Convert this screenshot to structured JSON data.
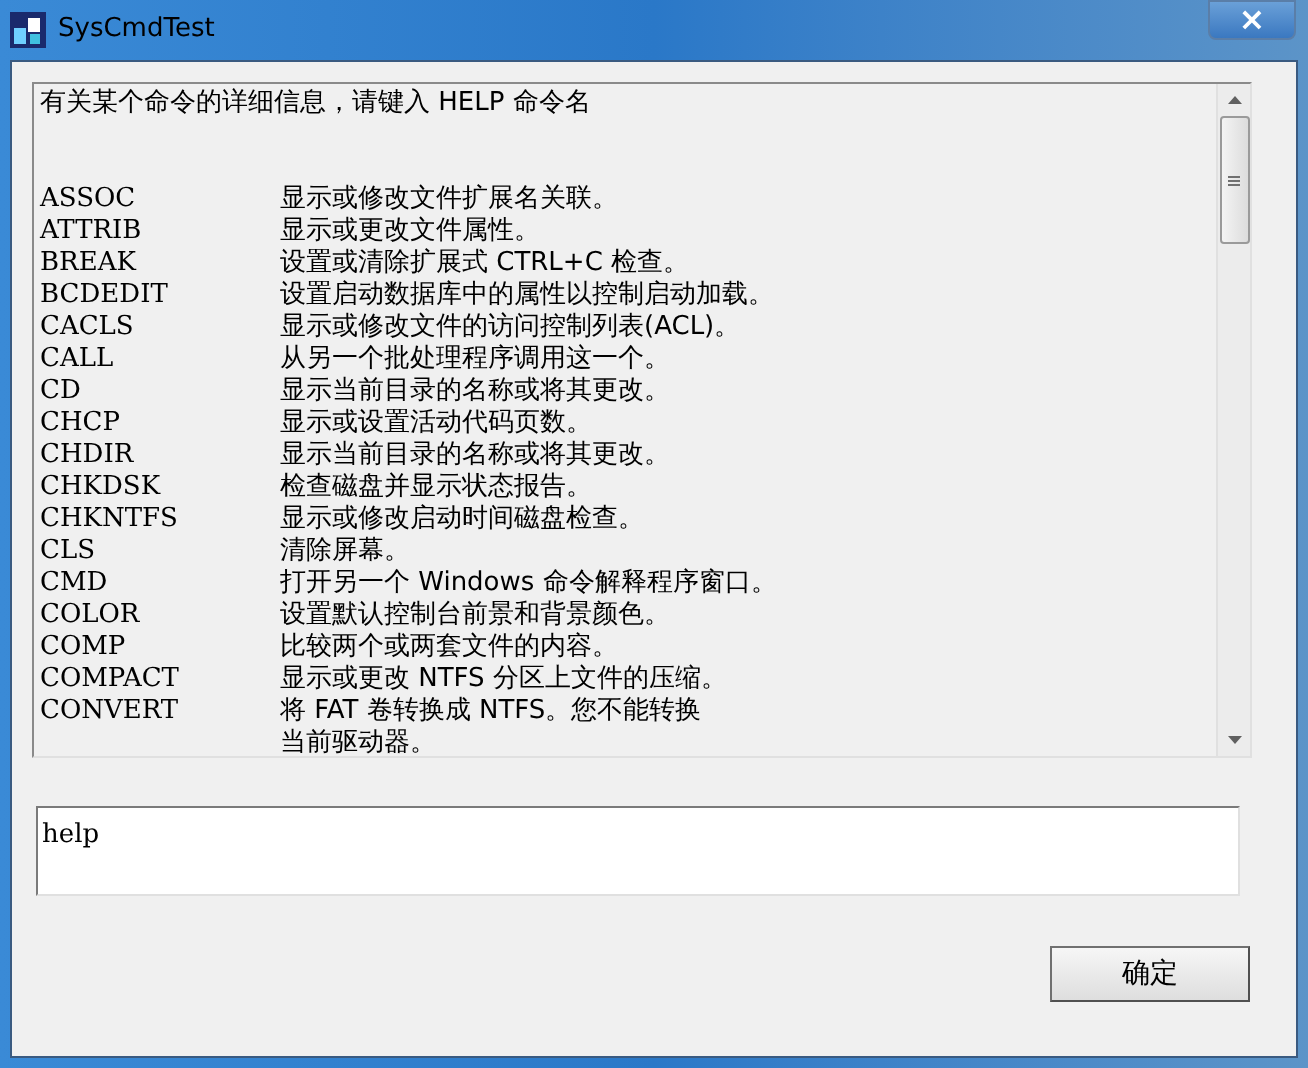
{
  "window": {
    "title": "SysCmdTest",
    "close_label": "×"
  },
  "output": {
    "header": "有关某个命令的详细信息，请键入 HELP 命令名",
    "rows": [
      {
        "command": "ASSOC",
        "description": "显示或修改文件扩展名关联。"
      },
      {
        "command": "ATTRIB",
        "description": "显示或更改文件属性。"
      },
      {
        "command": "BREAK",
        "description": "设置或清除扩展式 CTRL+C 检查。"
      },
      {
        "command": "BCDEDIT",
        "description": "设置启动数据库中的属性以控制启动加载。"
      },
      {
        "command": "CACLS",
        "description": "显示或修改文件的访问控制列表(ACL)。"
      },
      {
        "command": "CALL",
        "description": "从另一个批处理程序调用这一个。"
      },
      {
        "command": "CD",
        "description": "显示当前目录的名称或将其更改。"
      },
      {
        "command": "CHCP",
        "description": "显示或设置活动代码页数。"
      },
      {
        "command": "CHDIR",
        "description": "显示当前目录的名称或将其更改。"
      },
      {
        "command": "CHKDSK",
        "description": "检查磁盘并显示状态报告。"
      },
      {
        "command": "CHKNTFS",
        "description": "显示或修改启动时间磁盘检查。"
      },
      {
        "command": "CLS",
        "description": "清除屏幕。"
      },
      {
        "command": "CMD",
        "description": "打开另一个 Windows 命令解释程序窗口。"
      },
      {
        "command": "COLOR",
        "description": "设置默认控制台前景和背景颜色。"
      },
      {
        "command": "COMP",
        "description": "比较两个或两套文件的内容。"
      },
      {
        "command": "COMPACT",
        "description": "显示或更改 NTFS 分区上文件的压缩。"
      },
      {
        "command": "CONVERT",
        "description": "将 FAT 卷转换成 NTFS。您不能转换"
      },
      {
        "description": "当前驱动器。"
      }
    ]
  },
  "input": {
    "value": "help"
  },
  "buttons": [
    {
      "label": "确定"
    }
  ]
}
